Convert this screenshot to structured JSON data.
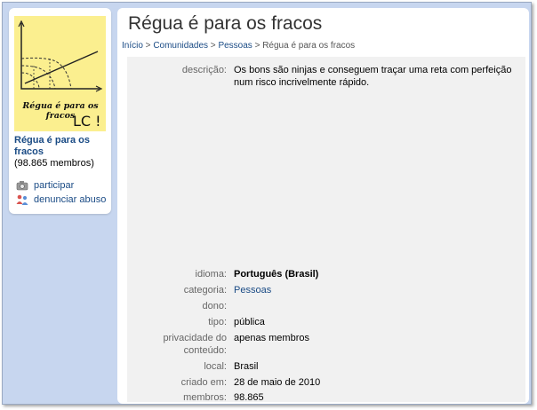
{
  "sidebar": {
    "logo_text_line1": "Régua é para os fracos",
    "logo_text_line2": "LC !",
    "community_name": "Régua é para os fracos",
    "member_count": "(98.865 membros)",
    "actions": [
      {
        "label": "participar",
        "icon": "camera-icon"
      },
      {
        "label": "denunciar abuso",
        "icon": "people-icon"
      }
    ]
  },
  "main": {
    "title": "Régua é para os fracos",
    "breadcrumb": [
      {
        "label": "Início",
        "link": true
      },
      {
        "label": "Comunidades",
        "link": true
      },
      {
        "label": "Pessoas",
        "link": true
      },
      {
        "label": "Régua é para os fracos",
        "link": false
      }
    ],
    "breadcrumb_sep": " > ",
    "details": {
      "descricao_label": "descrição:",
      "descricao_value": "Os bons são ninjas e conseguem traçar uma reta com perfeição num risco incrivelmente rápido.",
      "idioma_label": "idioma:",
      "idioma_value": "Português (Brasil)",
      "categoria_label": "categoria:",
      "categoria_value": "Pessoas",
      "dono_label": "dono:",
      "dono_value": "",
      "tipo_label": "tipo:",
      "tipo_value": "pública",
      "privacidade_label": "privacidade do conteúdo:",
      "privacidade_value": "apenas membros",
      "local_label": "local:",
      "local_value": "Brasil",
      "criado_label": "criado em:",
      "criado_value": "28 de maio de 2010",
      "membros_label": "membros:",
      "membros_value": "98.865"
    }
  },
  "colors": {
    "link": "#1a4b85",
    "background": "#c7d6ef",
    "logo_bg": "#fbef8f"
  }
}
